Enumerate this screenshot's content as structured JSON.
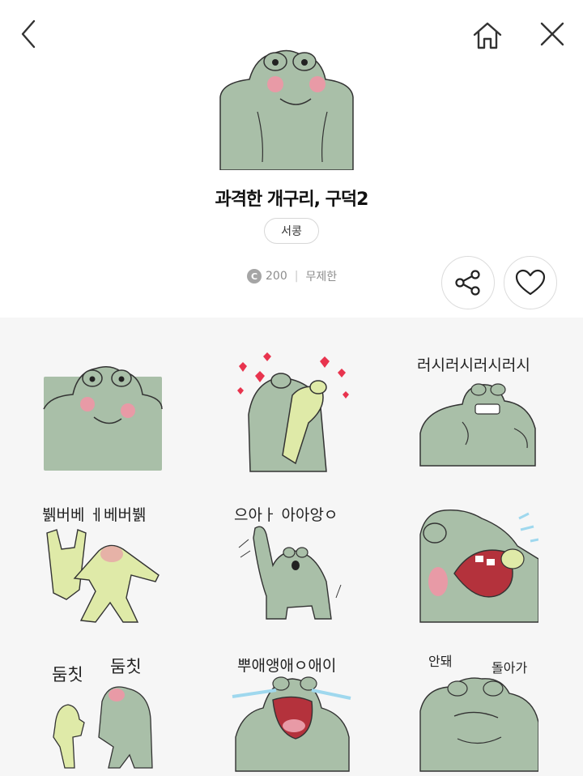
{
  "header": {
    "back_icon": "chevron-left-icon",
    "home_icon": "home-icon",
    "close_icon": "close-icon"
  },
  "product": {
    "title": "과격한 개구리, 구덕2",
    "author": "서콩",
    "price": "200",
    "coin_symbol": "C",
    "duration": "무제한"
  },
  "actions": {
    "share_icon": "share-icon",
    "like_icon": "heart-icon"
  },
  "stickers": [
    {
      "caption": ""
    },
    {
      "caption": ""
    },
    {
      "caption": "러시러시러시러시"
    },
    {
      "caption": "뷁버베 ㅔ베버뷁"
    },
    {
      "caption": "으아ㅏ 아아앙ㅇ"
    },
    {
      "caption": ""
    },
    {
      "caption_left": "둠칫",
      "caption_right": "둠칫"
    },
    {
      "caption": "뿌애앵애ㅇ애이"
    },
    {
      "caption_left": "안돼",
      "caption_right": "돌아가"
    }
  ],
  "colors": {
    "frog_green": "#a9bfa8",
    "frog_light": "#dfeaa8",
    "blush": "#e89aa6",
    "heart": "#e8344e",
    "tears": "#9fd8ee"
  }
}
